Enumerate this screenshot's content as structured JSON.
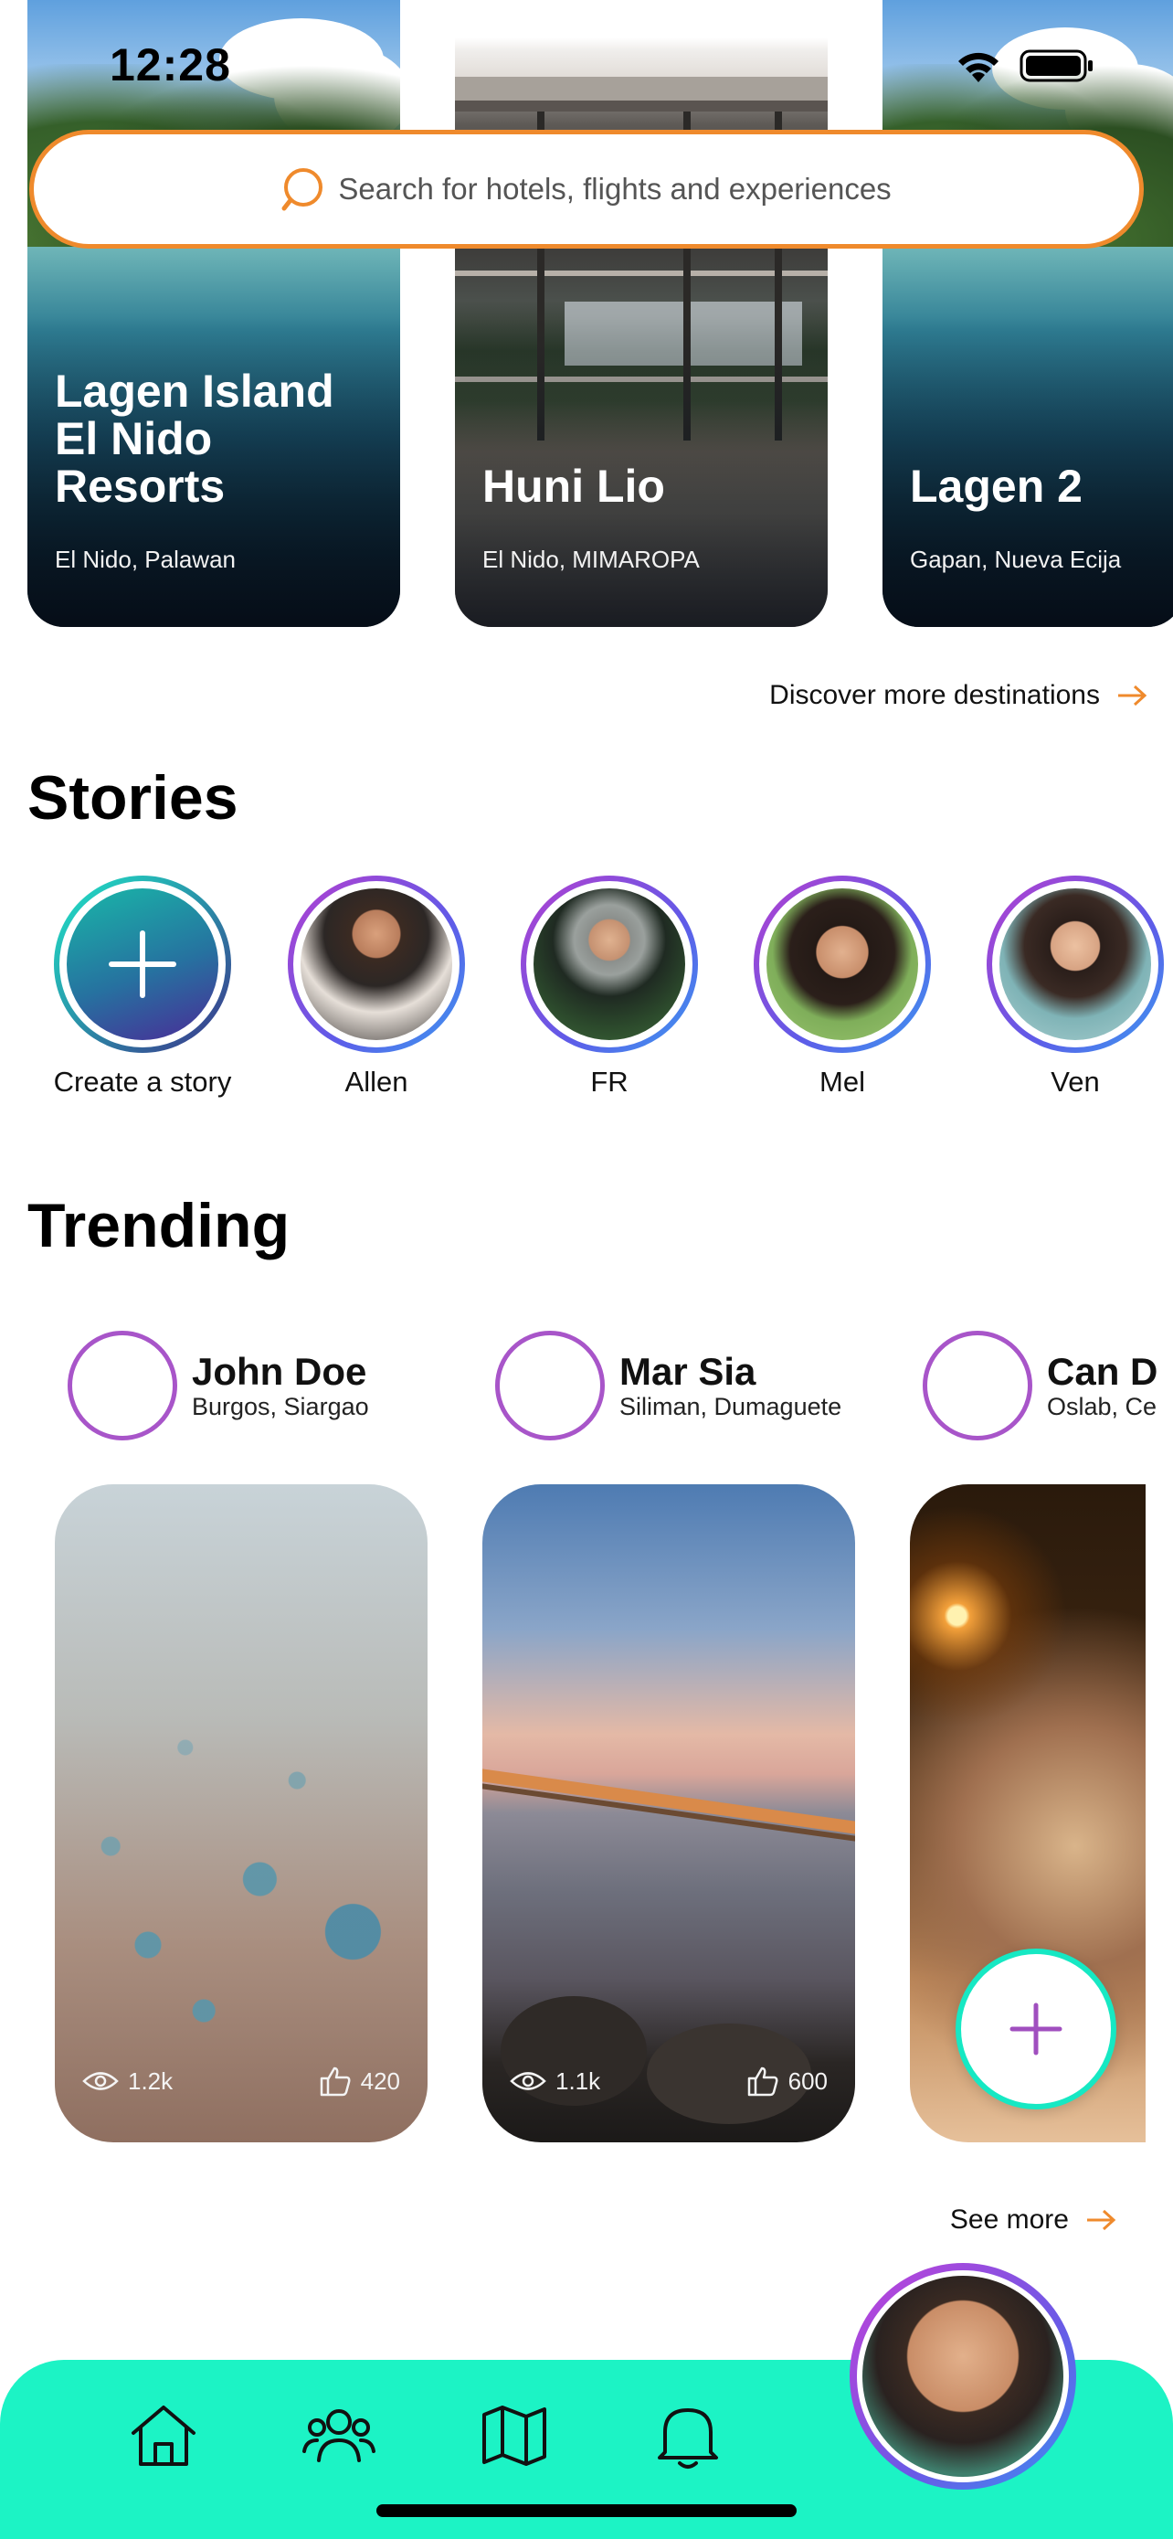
{
  "status_bar": {
    "time": "12:28"
  },
  "search": {
    "placeholder": "Search for hotels, flights and experiences"
  },
  "destinations": [
    {
      "title": "Lagen Island El Nido Resorts",
      "location": "El Nido, Palawan"
    },
    {
      "title": "Huni Lio",
      "location": "El Nido, MIMAROPA"
    },
    {
      "title": "Lagen 2",
      "location": "Gapan, Nueva Ecija"
    }
  ],
  "discover_more": "Discover more destinations",
  "stories": {
    "title": "Stories",
    "create_label": "Create a story",
    "items": [
      {
        "name": "Allen"
      },
      {
        "name": "FR"
      },
      {
        "name": "Mel"
      },
      {
        "name": "Ven"
      }
    ]
  },
  "trending": {
    "title": "Trending",
    "posts": [
      {
        "name": "John Doe",
        "location": "Burgos, Siargao",
        "views": "1.2k",
        "likes": "420"
      },
      {
        "name": "Mar Sia",
        "location": "Siliman, Dumaguete",
        "views": "1.1k",
        "likes": "600"
      },
      {
        "name": "Can D",
        "location": "Oslab, Ce",
        "views": "",
        "likes": ""
      }
    ]
  },
  "see_more": "See more",
  "colors": {
    "accent_orange": "#ef8a2c",
    "nav_teal": "#1cf3c5",
    "ring_purple": "#a855c9"
  },
  "nav": {
    "items": [
      "home-icon",
      "friends-icon",
      "map-icon",
      "bell-icon"
    ]
  }
}
